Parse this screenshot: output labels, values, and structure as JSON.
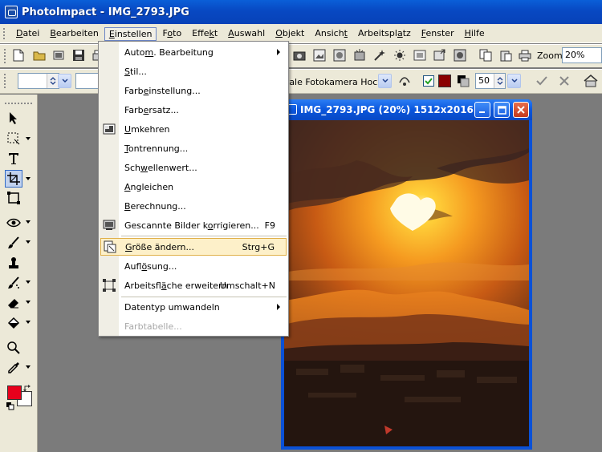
{
  "app": {
    "title": "PhotoImpact - IMG_2793.JPG"
  },
  "menubar": [
    {
      "pre": "",
      "u": "D",
      "post": "atei"
    },
    {
      "pre": "",
      "u": "B",
      "post": "earbeiten"
    },
    {
      "pre": "",
      "u": "E",
      "post": "instellen"
    },
    {
      "pre": "F",
      "u": "o",
      "post": "to"
    },
    {
      "pre": "Effe",
      "u": "k",
      "post": "t"
    },
    {
      "pre": "",
      "u": "A",
      "post": "uswahl"
    },
    {
      "pre": "",
      "u": "O",
      "post": "bjekt"
    },
    {
      "pre": "Ansich",
      "u": "t",
      "post": ""
    },
    {
      "pre": "Arbeitspl",
      "u": "a",
      "post": "tz"
    },
    {
      "pre": "",
      "u": "F",
      "post": "enster"
    },
    {
      "pre": "",
      "u": "H",
      "post": "ilfe"
    }
  ],
  "toolbar": {
    "zoom_label": "Zoom",
    "zoom_value": "20%",
    "preset": "tale Fotokamera Hochfo",
    "numeric_value": "50"
  },
  "colors": {
    "foreground": "#e8001c",
    "background": "#ffffff",
    "swatch_dark_red": "#8b0000",
    "accent_menu_highlight": "#fdf0c9"
  },
  "image_window": {
    "title": "IMG_2793.JPG (20%) 1512x2016"
  },
  "dropdown": {
    "items": [
      {
        "pre": "Auto",
        "u": "m",
        "post": ". Bearbeitung",
        "shortcut": "",
        "submenu": true,
        "icon": ""
      },
      {
        "pre": "",
        "u": "S",
        "post": "til...",
        "shortcut": "",
        "submenu": false,
        "icon": ""
      },
      {
        "pre": "Farb",
        "u": "e",
        "post": "instellung...",
        "shortcut": "",
        "submenu": false,
        "icon": ""
      },
      {
        "pre": "Farb",
        "u": "e",
        "post": "rsatz...",
        "shortcut": "",
        "submenu": false,
        "icon": ""
      },
      {
        "pre": "",
        "u": "U",
        "post": "mkehren",
        "shortcut": "",
        "submenu": false,
        "icon": "invert-icon"
      },
      {
        "pre": "",
        "u": "T",
        "post": "ontrennung...",
        "shortcut": "",
        "submenu": false,
        "icon": ""
      },
      {
        "pre": "Sch",
        "u": "w",
        "post": "ellenwert...",
        "shortcut": "",
        "submenu": false,
        "icon": ""
      },
      {
        "pre": "",
        "u": "A",
        "post": "ngleichen",
        "shortcut": "",
        "submenu": false,
        "icon": ""
      },
      {
        "pre": "",
        "u": "B",
        "post": "erechnung...",
        "shortcut": "",
        "submenu": false,
        "icon": ""
      },
      {
        "pre": "Gescannte Bilder k",
        "u": "o",
        "post": "rrigieren...",
        "shortcut": "F9",
        "submenu": false,
        "icon": "scan-correct-icon"
      },
      {
        "pre": "",
        "u": "G",
        "post": "röße ändern...",
        "shortcut": "Strg+G",
        "submenu": false,
        "icon": "resize-icon",
        "highlighted": true
      },
      {
        "pre": "Aufl",
        "u": "ö",
        "post": "sung...",
        "shortcut": "",
        "submenu": false,
        "icon": ""
      },
      {
        "pre": "Arbeitsfl",
        "u": "ä",
        "post": "che erweitern",
        "shortcut": "Umschalt+N",
        "submenu": false,
        "icon": "canvas-expand-icon"
      },
      {
        "pre": "Datentyp umwandeln",
        "u": "",
        "post": "",
        "shortcut": "",
        "submenu": true,
        "icon": ""
      },
      {
        "pre": "Farbtabelle...",
        "u": "",
        "post": "",
        "shortcut": "",
        "submenu": false,
        "icon": "",
        "disabled": true
      }
    ]
  }
}
